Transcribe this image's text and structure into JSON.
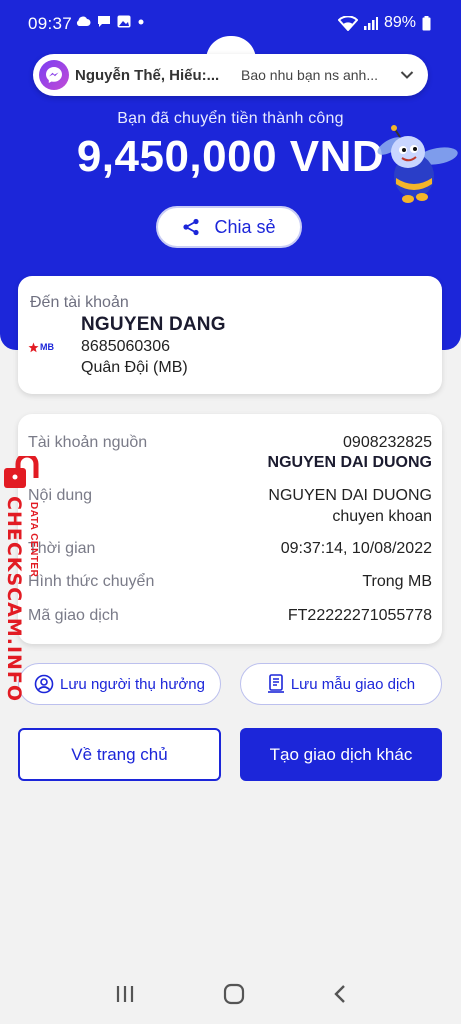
{
  "status_bar": {
    "time": "09:37",
    "battery": "89%"
  },
  "chat_head": {
    "name": "Nguyễn Thế, Hiếu:...",
    "message": "Bao nhu bạn ns anh..."
  },
  "hero": {
    "success_text": "Bạn đã chuyển tiền thành công",
    "amount": "9,450,000 VND"
  },
  "share": {
    "label": "Chia sẻ"
  },
  "destination": {
    "label": "Đến tài khoản",
    "bank_logo": "MB",
    "name": "NGUYEN DANG",
    "account": "8685060306",
    "bank": "Quân Đội (MB)"
  },
  "details": {
    "source_label": "Tài khoản nguồn",
    "source_account": "0908232825",
    "source_name": "NGUYEN DAI DUONG",
    "content_label": "Nội dung",
    "content_line1": "NGUYEN DAI DUONG",
    "content_line2": "chuyen khoan",
    "time_label": "Thời gian",
    "time_value": "09:37:14, 10/08/2022",
    "method_label": "Hình thức chuyển",
    "method_value": "Trong MB",
    "tx_label": "Mã giao dịch",
    "tx_value": "FT22222271055778"
  },
  "actions": {
    "save_beneficiary": "Lưu người thụ hưởng",
    "save_template": "Lưu mẫu giao dịch",
    "home": "Về trang chủ",
    "new_transaction": "Tạo giao dịch khác"
  },
  "watermark": {
    "main": "CHECKSCAM.INFO",
    "sub": "DATA CENTER"
  },
  "colors": {
    "brand": "#1c26d9",
    "watermark": "#e21b23"
  }
}
